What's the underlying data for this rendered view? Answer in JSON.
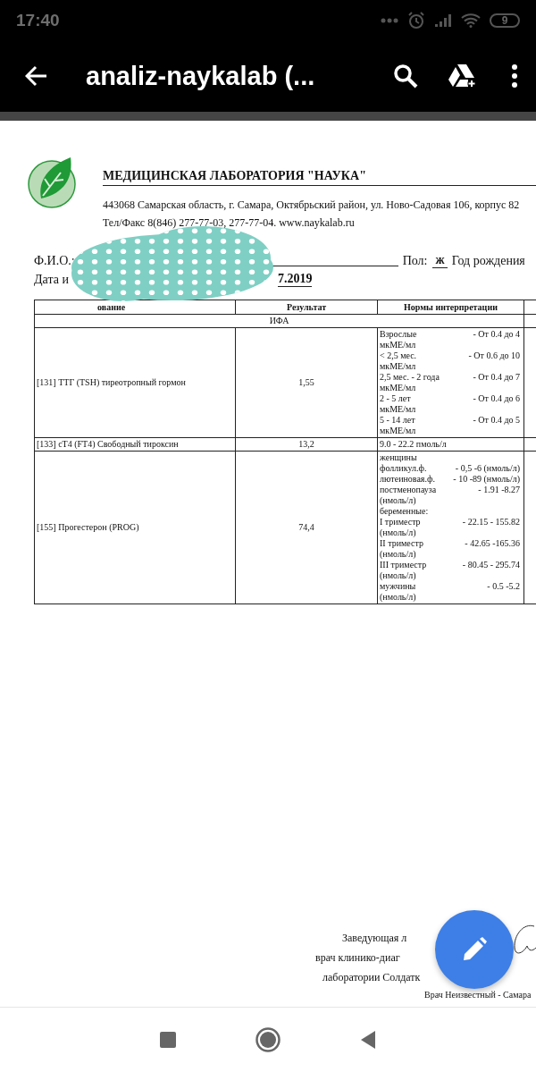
{
  "status_bar": {
    "time": "17:40",
    "battery": "9"
  },
  "app_bar": {
    "title": "analiz-naykalab (..."
  },
  "document": {
    "lab_name": "МЕДИЦИНСКАЯ ЛАБОРАТОРИЯ \"НАУКА\"",
    "address": "443068 Самарская область, г. Самара, Октябрьский район, ул. Ново-Садовая 106, корпус 82",
    "phone": "Тел/Факс 8(846) 277-77-03, 277-77-04. www.naykalab.ru",
    "fio_label": "Ф.И.О.:",
    "sex_label": "Пол:",
    "sex_value": "ж",
    "birth_label": "Год рождения",
    "date_label": "Дата и",
    "date_value": "7.2019",
    "table": {
      "columns": [
        "ование",
        "Результат",
        "Нормы интерпретации"
      ],
      "group": "ИФА",
      "rows": [
        {
          "name": "[131] ТТГ (TSH) тиреотропный гормон",
          "result": "1,55",
          "norms": [
            {
              "label": "Взрослые",
              "value": "-  От 0.4 до  4",
              "unit": "мкМЕ/мл"
            },
            {
              "label": "< 2,5 мес.",
              "value": "-  От 0.6 до 10",
              "unit": "мкМЕ/мл"
            },
            {
              "label": "2,5 мес. - 2 года",
              "value": "-  От 0.4 до 7",
              "unit": "мкМЕ/мл"
            },
            {
              "label": "2 - 5 лет",
              "value": "-  От 0.4 до 6",
              "unit": "мкМЕ/мл"
            },
            {
              "label": "5 - 14 лет",
              "value": "-  От 0.4 до 5",
              "unit": "мкМЕ/мл"
            }
          ]
        },
        {
          "name": "[133] сТ4 (FT4) Свободный тироксин",
          "result": "13,2",
          "norms": [
            {
              "label": "9.0 - 22.2 пмоль/л"
            }
          ]
        },
        {
          "name": "[155] Прогестерон (PROG)",
          "result": "74,4",
          "norms": [
            {
              "label": "женщины"
            },
            {
              "label": "фолликул.ф.",
              "value": "- 0,5 -6 (нмоль/л)"
            },
            {
              "label": "лютеиновая.ф.",
              "value": "- 10 -89 (нмоль/л)"
            },
            {
              "label": "постменопауза",
              "value": "- 1.91 -8.27",
              "unit": "(нмоль/л)"
            },
            {
              "label": "беременные:"
            },
            {
              "label": "I триместр",
              "value": "- 22.15 - 155.82",
              "unit": "(нмоль/л)"
            },
            {
              "label": "II триместр",
              "value": "- 42.65 -165.36",
              "unit": "(нмоль/л)"
            },
            {
              "label": "III триместр",
              "value": "- 80.45 - 295.74",
              "unit": "(нмоль/л)"
            },
            {
              "label": "мужчины",
              "value": "- 0.5 -5.2",
              "unit": "(нмоль/л)"
            }
          ]
        }
      ]
    },
    "signature_lines": [
      "Заведующая л",
      "врач клинико-диаг",
      "лаборатории Солдатк"
    ],
    "footer": "Врач Неизвестный - Самара"
  }
}
